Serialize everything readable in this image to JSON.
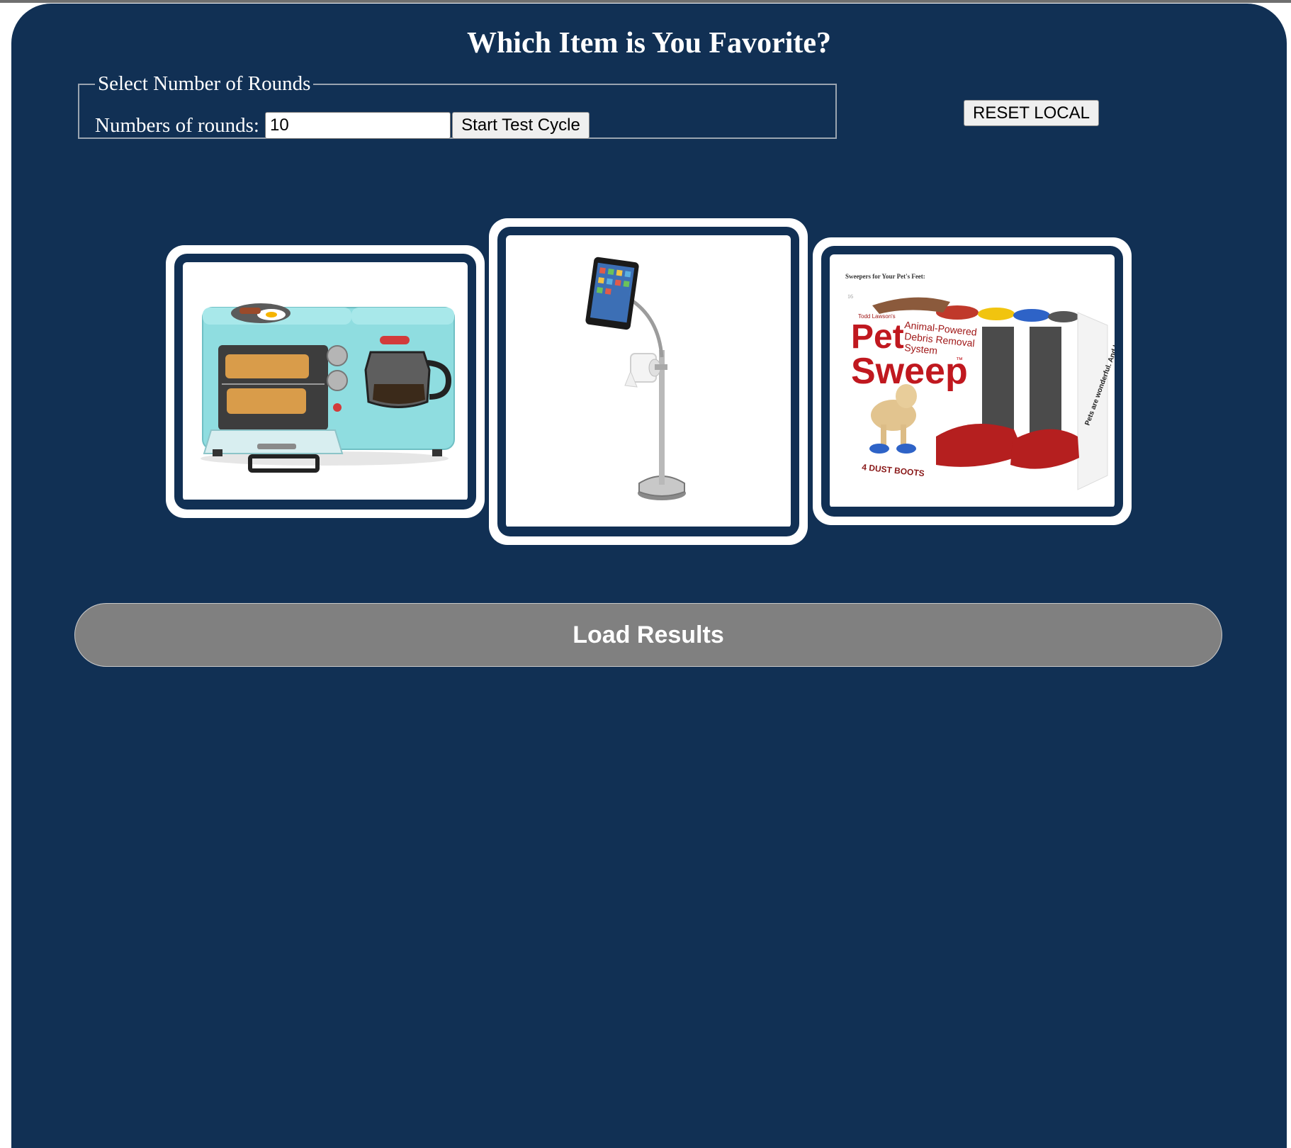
{
  "page": {
    "title": "Which Item is You Favorite?"
  },
  "rounds": {
    "legend": "Select Number of Rounds",
    "label": "Numbers of rounds:",
    "value": "10",
    "start_button": "Start Test Cycle"
  },
  "reset_button": "RESET LOCAL",
  "products": [
    {
      "name": "breakfast-station",
      "image": "breakfast-station-image"
    },
    {
      "name": "ipad-toilet-paper-stand",
      "image": "ipad-toilet-paper-stand-image"
    },
    {
      "name": "pet-sweep",
      "image": "pet-sweep-image",
      "box_texts": {
        "tagline": "Sweepers for Your Pet's Feet:",
        "brand_line": "Todd Lawson's",
        "name_top": "Pet",
        "name_bottom": "Sweep",
        "trademark": "™",
        "desc_1": "Animal-Powered",
        "desc_2": "Debris Removal",
        "desc_3": "System",
        "boots": "4 DUST BOOTS",
        "side": "Pets are wonderful. And lazy."
      }
    }
  ],
  "load_button": "Load Results",
  "colors": {
    "background": "#113054",
    "card_border": "#ffffff",
    "load_button": "#808080"
  }
}
